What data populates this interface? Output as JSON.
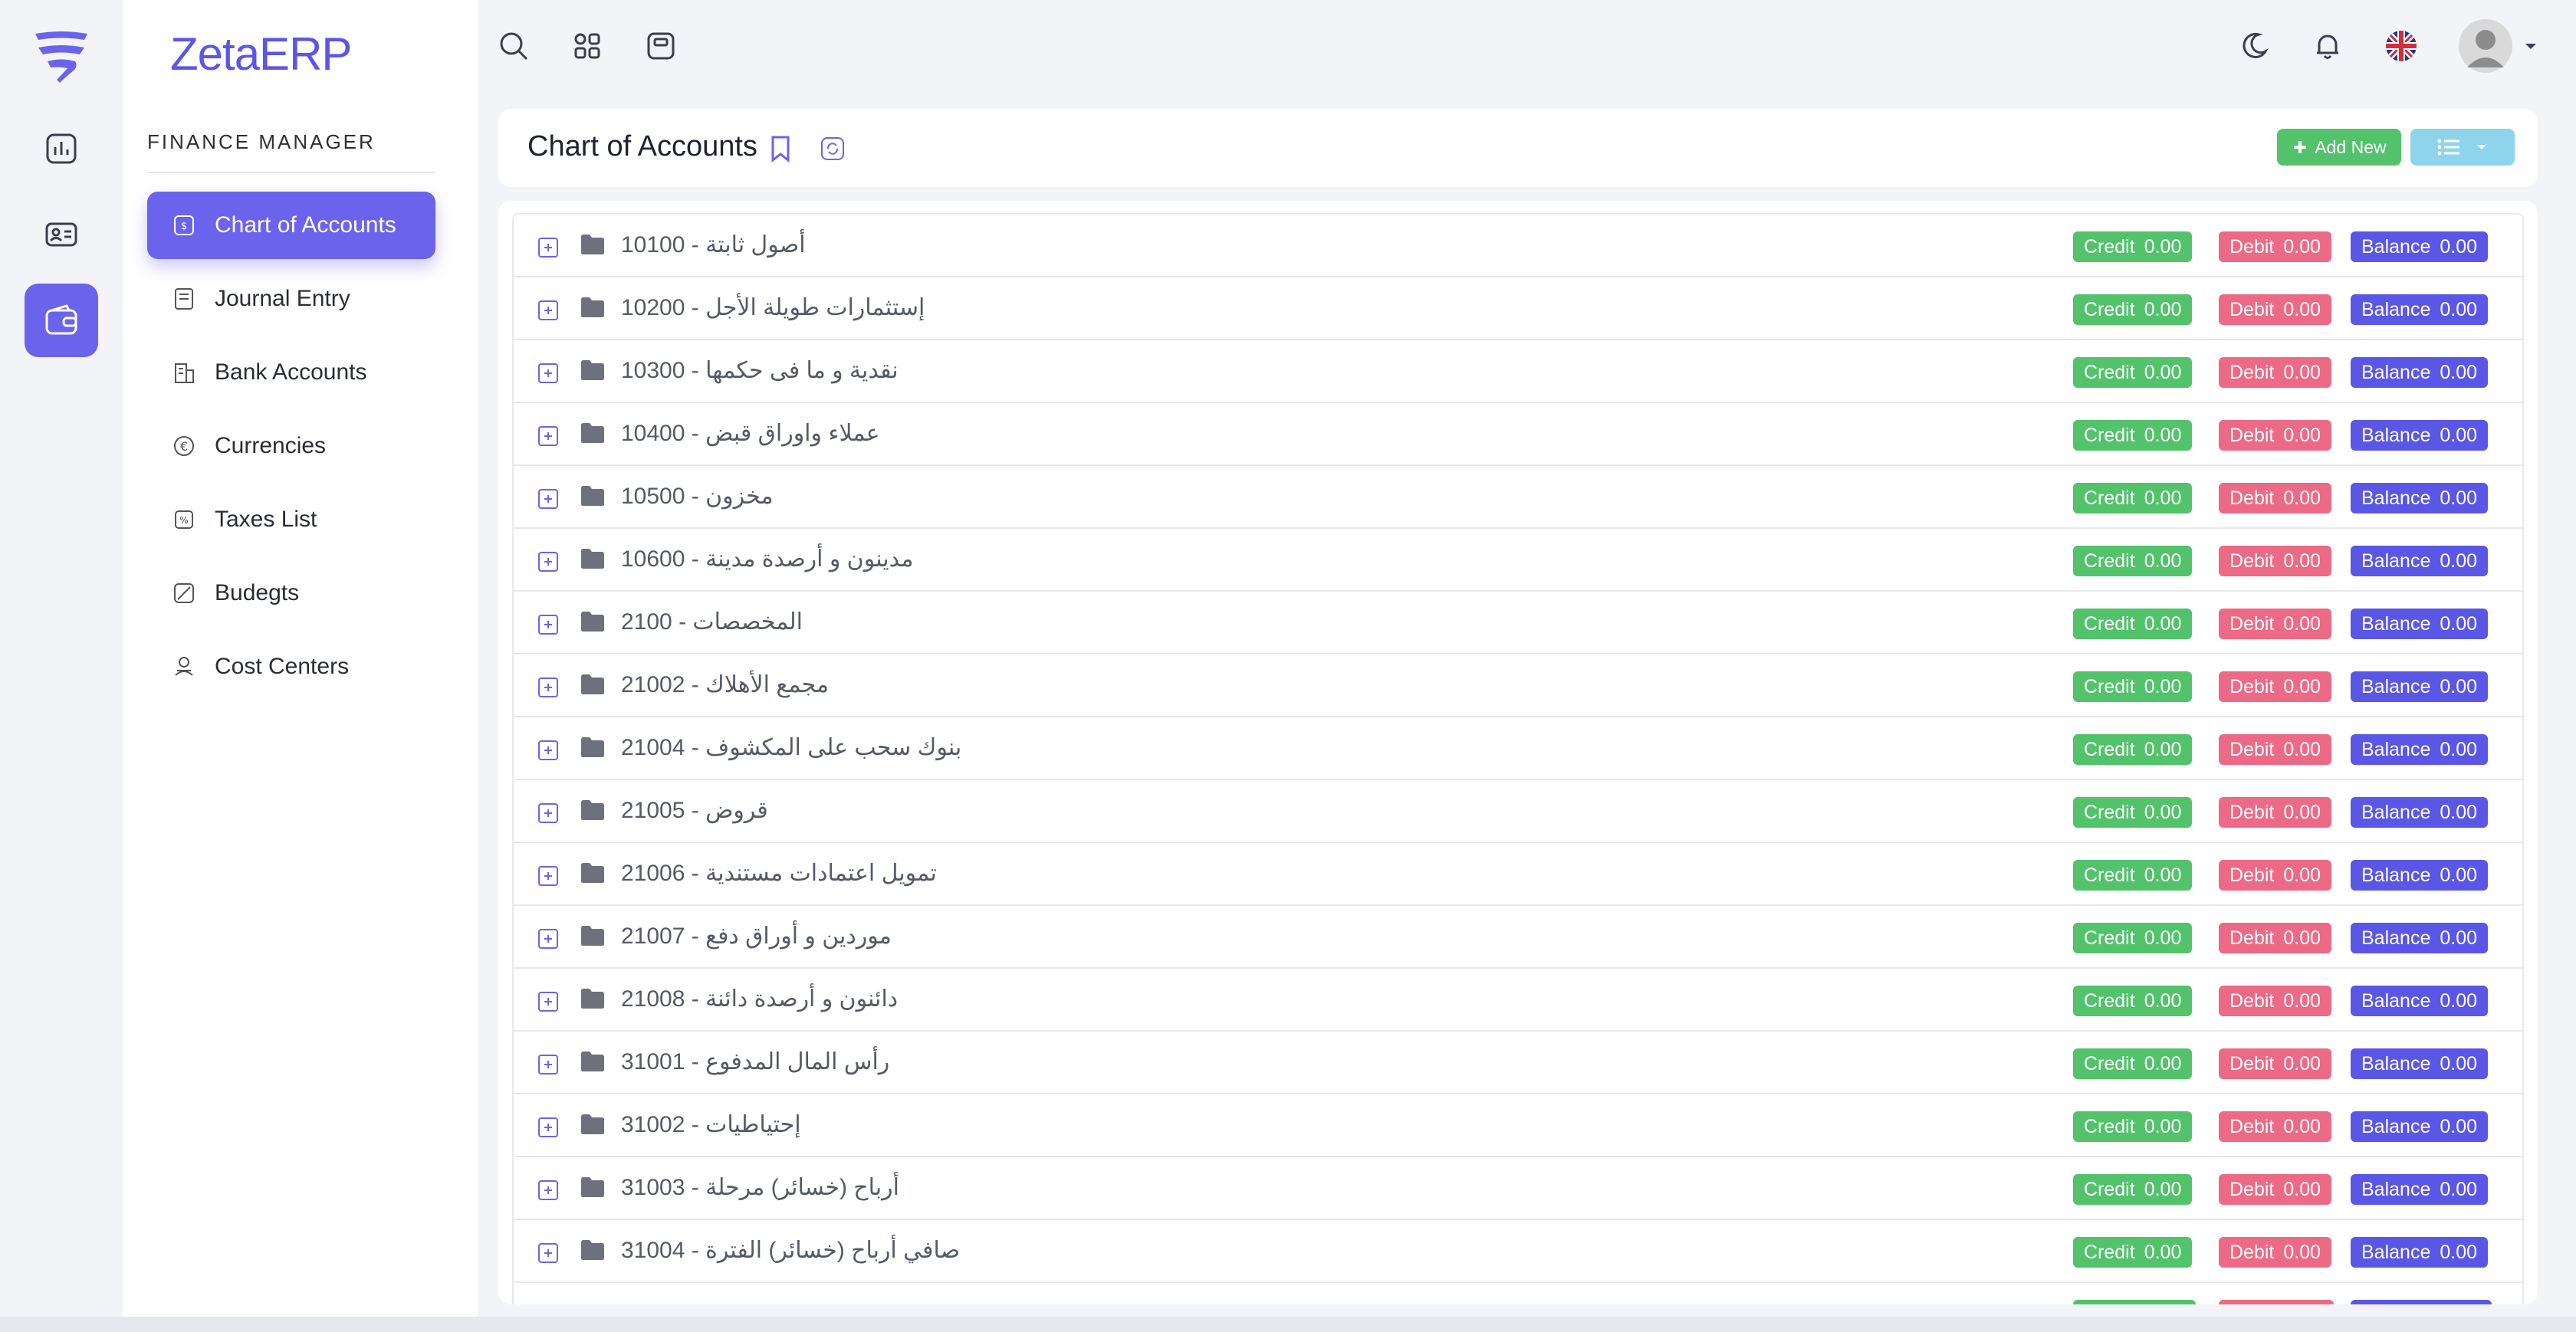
{
  "app": {
    "brand": "ZetaERP"
  },
  "rail": {
    "items": [
      {
        "icon": "bar-chart-icon",
        "active": false
      },
      {
        "icon": "contact-card-icon",
        "active": false
      },
      {
        "icon": "wallet-icon",
        "active": true
      }
    ]
  },
  "sidebar": {
    "section_title": "FINANCE MANAGER",
    "items": [
      {
        "label": "Chart of Accounts",
        "icon": "chart-accounts-icon",
        "active": true
      },
      {
        "label": "Journal Entry",
        "icon": "journal-icon",
        "active": false
      },
      {
        "label": "Bank Accounts",
        "icon": "bank-icon",
        "active": false
      },
      {
        "label": "Currencies",
        "icon": "euro-icon",
        "active": false
      },
      {
        "label": "Taxes List",
        "icon": "taxes-icon",
        "active": false
      },
      {
        "label": "Budegts",
        "icon": "budget-icon",
        "active": false
      },
      {
        "label": "Cost Centers",
        "icon": "cost-center-icon",
        "active": false
      }
    ]
  },
  "topbar": {
    "icons": [
      "search-icon",
      "apps-grid-icon",
      "calculator-icon",
      "moon-icon",
      "bell-icon",
      "uk-flag-icon",
      "avatar"
    ]
  },
  "header": {
    "title": "Chart of Accounts",
    "add_label": "Add New"
  },
  "pill_labels": {
    "credit": "Credit",
    "debit": "Debit",
    "balance": "Balance"
  },
  "colors": {
    "accent": "#6c63ec",
    "credit": "#52c36b",
    "debit": "#ec6a86",
    "balance": "#5b57e6"
  },
  "accounts": [
    {
      "code": "10100",
      "name": "أصول ثابتة",
      "credit": "0.00",
      "debit": "0.00",
      "balance": "0.00"
    },
    {
      "code": "10200",
      "name": "إستثمارات طويلة الأجل",
      "credit": "0.00",
      "debit": "0.00",
      "balance": "0.00"
    },
    {
      "code": "10300",
      "name": "نقدية و ما فى حكمها",
      "credit": "0.00",
      "debit": "0.00",
      "balance": "0.00"
    },
    {
      "code": "10400",
      "name": "عملاء واوراق قبض",
      "credit": "0.00",
      "debit": "0.00",
      "balance": "0.00"
    },
    {
      "code": "10500",
      "name": "مخزون",
      "credit": "0.00",
      "debit": "0.00",
      "balance": "0.00"
    },
    {
      "code": "10600",
      "name": "مدينون و أرصدة مدينة",
      "credit": "0.00",
      "debit": "0.00",
      "balance": "0.00"
    },
    {
      "code": "2100",
      "name": "المخصصات",
      "credit": "0.00",
      "debit": "0.00",
      "balance": "0.00"
    },
    {
      "code": "21002",
      "name": "مجمع الأهلاك",
      "credit": "0.00",
      "debit": "0.00",
      "balance": "0.00"
    },
    {
      "code": "21004",
      "name": "بنوك سحب على المكشوف",
      "credit": "0.00",
      "debit": "0.00",
      "balance": "0.00"
    },
    {
      "code": "21005",
      "name": "قروض",
      "credit": "0.00",
      "debit": "0.00",
      "balance": "0.00"
    },
    {
      "code": "21006",
      "name": "تمويل اعتمادات مستندية",
      "credit": "0.00",
      "debit": "0.00",
      "balance": "0.00"
    },
    {
      "code": "21007",
      "name": "موردين و أوراق دفع",
      "credit": "0.00",
      "debit": "0.00",
      "balance": "0.00"
    },
    {
      "code": "21008",
      "name": "دائنون و أرصدة دائنة",
      "credit": "0.00",
      "debit": "0.00",
      "balance": "0.00"
    },
    {
      "code": "31001",
      "name": "رأس المال المدفوع",
      "credit": "0.00",
      "debit": "0.00",
      "balance": "0.00"
    },
    {
      "code": "31002",
      "name": "إحتياطيات",
      "credit": "0.00",
      "debit": "0.00",
      "balance": "0.00"
    },
    {
      "code": "31003",
      "name": "أرباح (خسائر) مرحلة",
      "credit": "0.00",
      "debit": "0.00",
      "balance": "0.00"
    },
    {
      "code": "31004",
      "name": "صافي أرباح (خسائر) الفترة",
      "credit": "0.00",
      "debit": "0.00",
      "balance": "0.00"
    }
  ]
}
